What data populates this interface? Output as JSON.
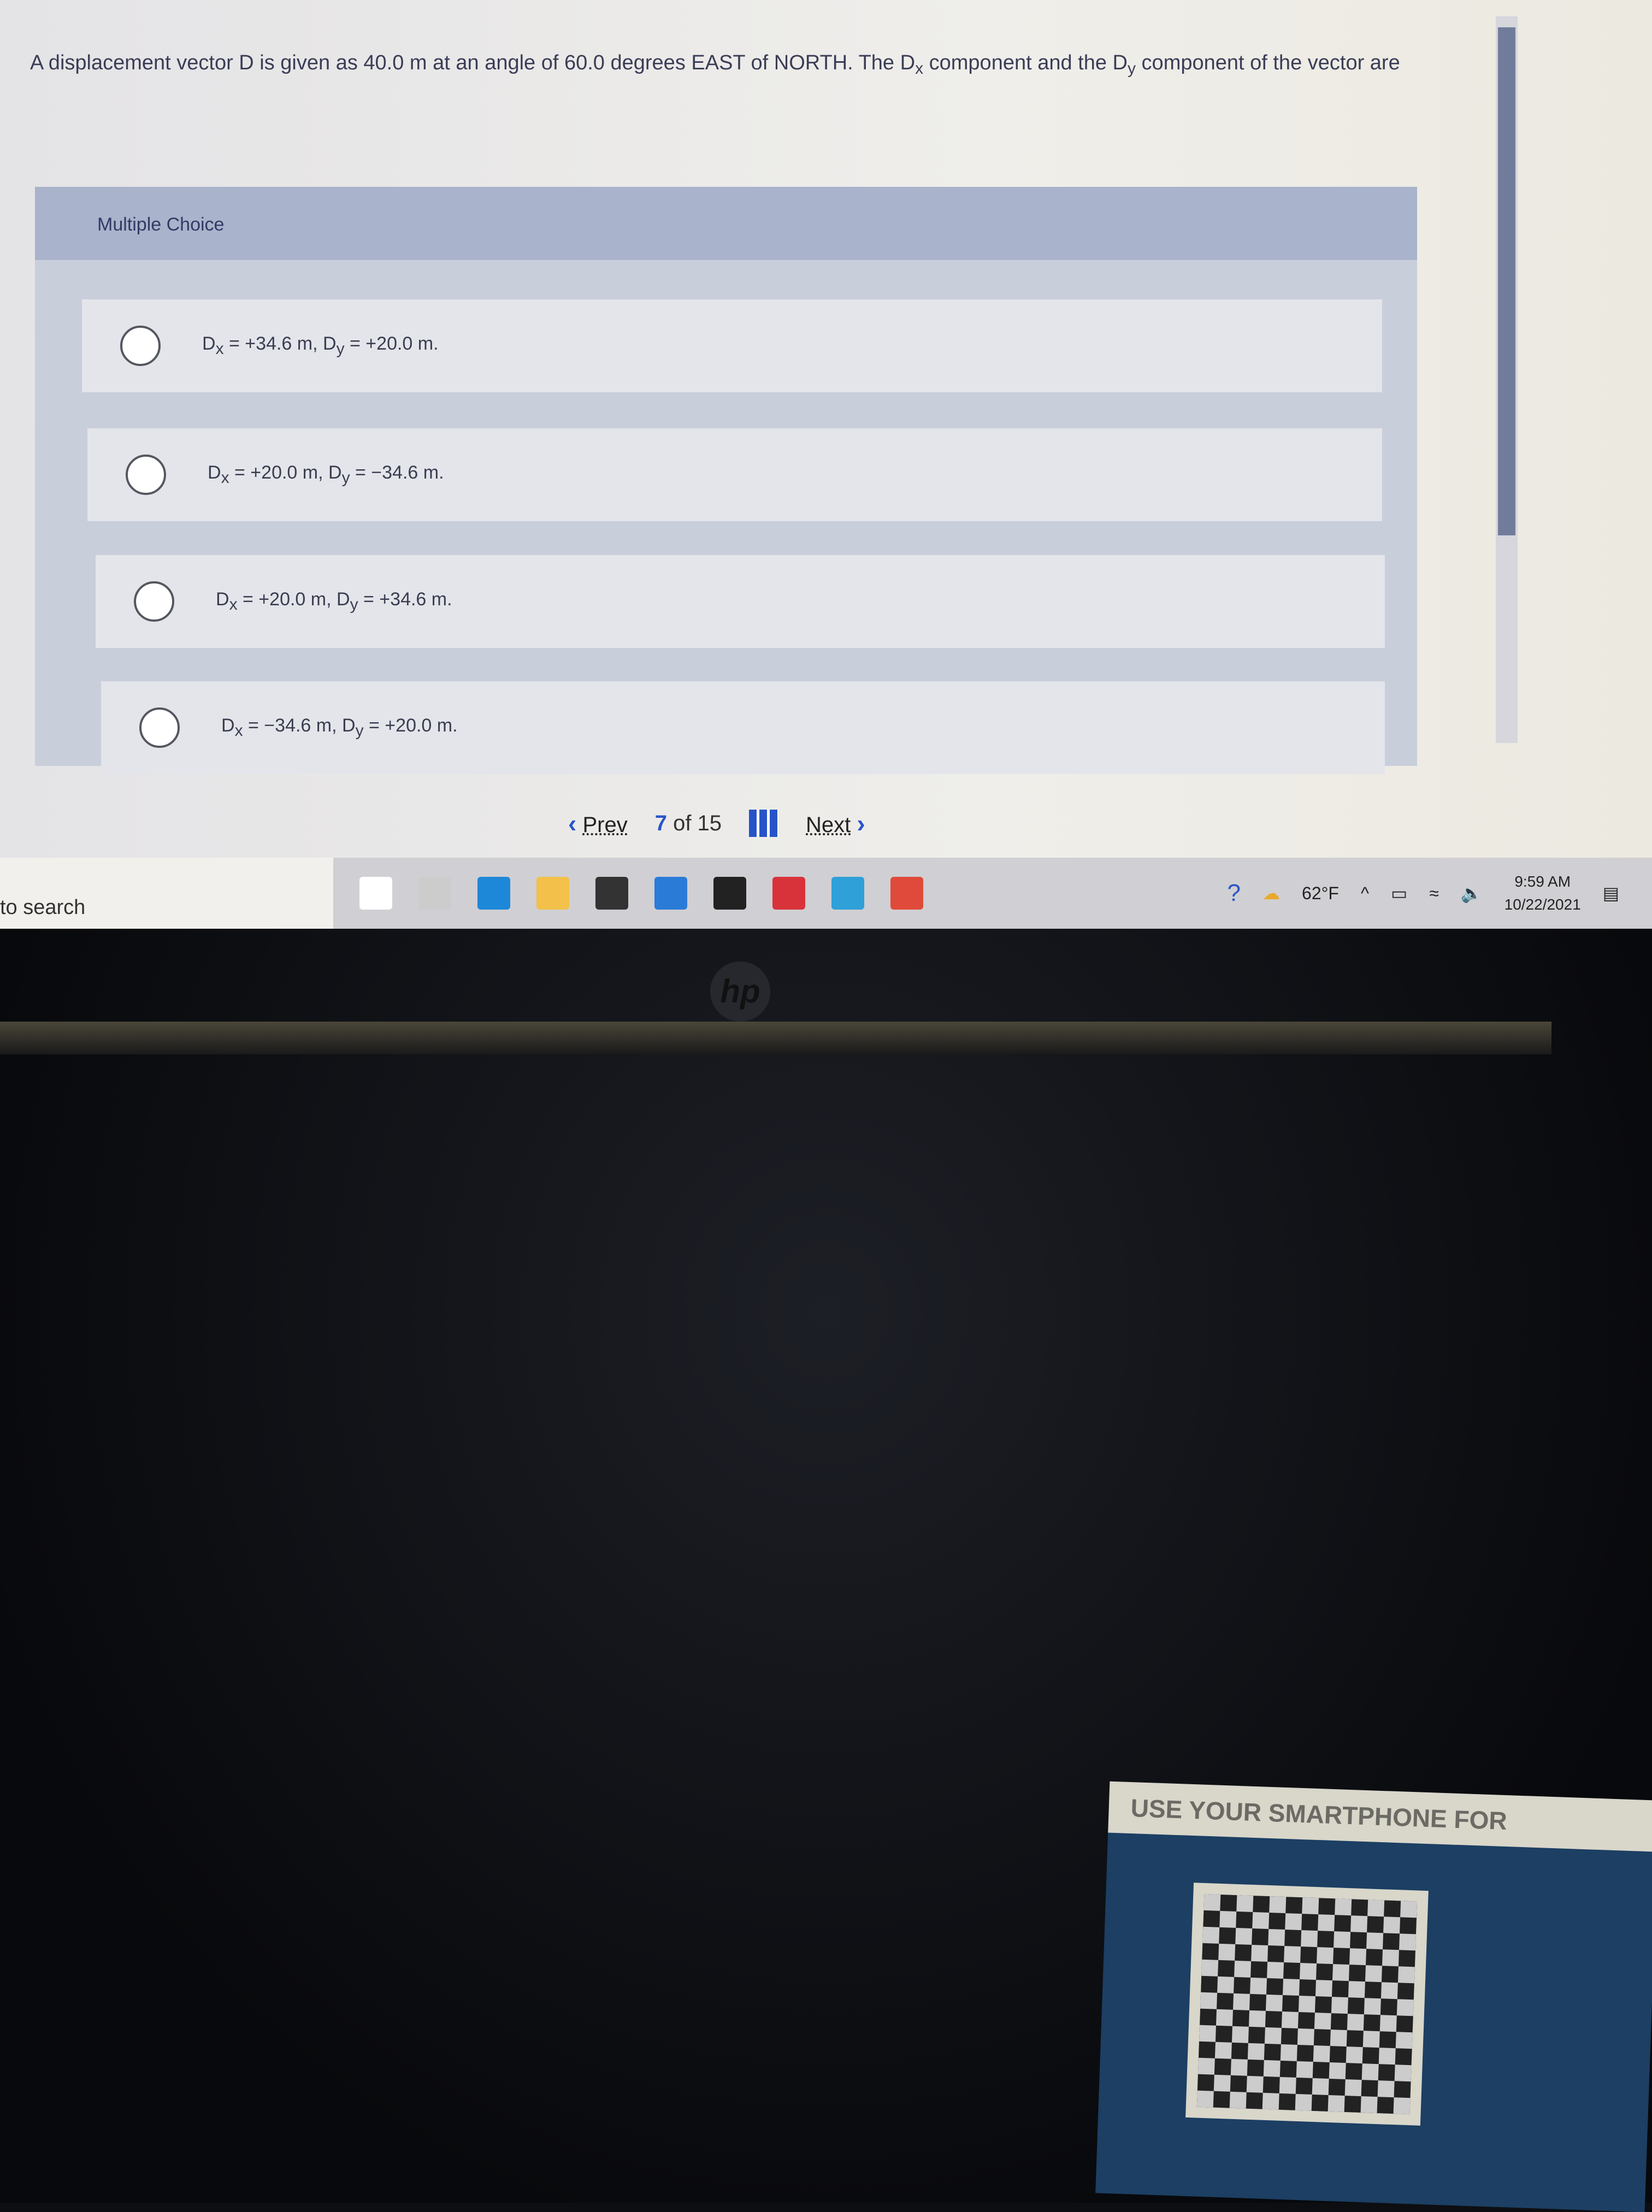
{
  "question": {
    "pre": "A displacement vector D is given as 40.0 m at an angle of 60.0 degrees EAST of NORTH. The D",
    "sub1": "x",
    "mid": " component and the D",
    "sub2": "y",
    "post": " component of the vector are"
  },
  "panel": {
    "title": "Multiple Choice",
    "options": [
      {
        "a": "D",
        "as": "x",
        "b": " = +34.6 m, D",
        "bs": "y",
        "c": " = +20.0 m."
      },
      {
        "a": "D",
        "as": "x",
        "b": " = +20.0 m, D",
        "bs": "y",
        "c": " = −34.6 m."
      },
      {
        "a": "D",
        "as": "x",
        "b": " = +20.0 m, D",
        "bs": "y",
        "c": " = +34.6 m."
      },
      {
        "a": "D",
        "as": "x",
        "b": " = −34.6 m, D",
        "bs": "y",
        "c": " = +20.0 m."
      }
    ]
  },
  "pager": {
    "prev": "Prev",
    "current": "7",
    "of": "of 15",
    "next": "Next"
  },
  "taskbar": {
    "search": "to search",
    "weather": "62°F",
    "time": "9:59 AM",
    "date": "10/22/2021",
    "icons": [
      "cortana-icon",
      "task-view-icon",
      "edge-icon",
      "file-explorer-icon",
      "store-icon",
      "mail-icon",
      "dropbox-icon",
      "app-icon",
      "ie-icon",
      "chrome-icon"
    ]
  },
  "laptop": {
    "logo": "hp",
    "card": "USE YOUR SMARTPHONE FOR"
  }
}
